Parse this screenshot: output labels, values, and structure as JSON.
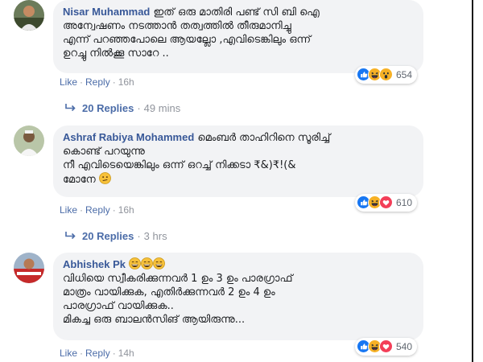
{
  "comments": [
    {
      "author": "Nisar Muhammad",
      "lines": [
        "ഇത് ഒരു മാതിരി പണ്ട് സി ബി ഐ",
        "അന്വേഷണം നടത്താൻ തത്വത്തിൽ തീരുമാനിച്ചു",
        "എന്ന് പറഞ്ഞപോലെ ആയല്ലോ ,എവിടെങ്കിലും ഒന്ന്",
        "ഉറച്ചു നിൽക്കൂ സാറേ .."
      ],
      "like_label": "Like",
      "reply_label": "Reply",
      "time": "16h",
      "reaction_count": "654",
      "reactions": [
        "like",
        "haha",
        "wow"
      ],
      "replies_label": "20 Replies",
      "replies_time": "49 mins"
    },
    {
      "author": "Ashraf Rabiya Mohammed",
      "lines": [
        "മെംബർ താഹിറിനെ സൂരിച്ച്",
        "കൊണ്ട് പറയുന്നു",
        "നീ എവിടെയെങ്കിലും ഒന്ന് ഒറച്ച് നിക്കടാ ₹&)₹!(&",
        "മോനേ"
      ],
      "like_label": "Like",
      "reply_label": "Reply",
      "time": "16h",
      "reaction_count": "610",
      "reactions": [
        "like",
        "haha",
        "love"
      ],
      "replies_label": "20 Replies",
      "replies_time": "3 hrs"
    },
    {
      "author": "Abhishek Pk",
      "lines": [
        "വിധിയെ സ്വീകരിക്കുന്നവർ 1 ഉം 3 ഉം പാരഗ്രാഫ്",
        "മാത്രം വായിക്കുക, എതിർക്കുന്നവർ 2 ഉം 4 ഉം",
        "പാരഗ്രാഫ് വായിക്കുക..",
        "മികച്ച ഒരു ബാലൻസിങ് ആയിരുന്നു..."
      ],
      "like_label": "Like",
      "reply_label": "Reply",
      "time": "14h",
      "reaction_count": "540",
      "reactions": [
        "like",
        "haha",
        "love"
      ]
    }
  ],
  "colors": {
    "link": "#385898",
    "action": "#4b6ca8",
    "muted": "#90949c",
    "bubble": "#f2f3f5",
    "like": "#1877f2",
    "love": "#f33e58",
    "haha": "#f7b125"
  },
  "icons": {
    "reply_arrow": "reply-arrow-icon",
    "like": "like-reaction-icon",
    "haha": "haha-reaction-icon",
    "wow": "wow-reaction-icon",
    "love": "love-reaction-icon",
    "confused_emoji": "confused-emoji-icon",
    "grin_emoji": "grinning-emoji-icon"
  }
}
